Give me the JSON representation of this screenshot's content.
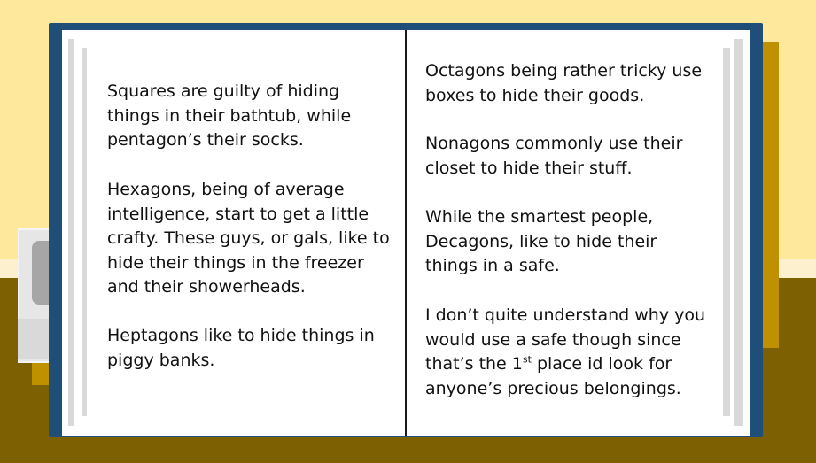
{
  "colors": {
    "wall": "#fee89c",
    "floor": "#7d6001",
    "gold": "#bf9000",
    "book_cover": "#1f4e79",
    "page": "#ffffff",
    "page_edge": "#d9d9d9"
  },
  "left_page": {
    "p1": "Squares are guilty of hiding\nthings in their bathtub, while\npentagon’s their socks.",
    "p2": "Hexagons, being of average\nintelligence, start to get a little\ncrafty. These guys, or gals, like to\nhide their things in the freezer\nand their showerheads.",
    "p3": "Heptagons like to hide things in\npiggy banks."
  },
  "right_page": {
    "p1": "Octagons being rather tricky use\nboxes to hide their goods.",
    "p2": "Nonagons commonly use their\ncloset to hide their stuff.",
    "p3": "While the smartest people,\nDecagons, like to hide their\nthings in a safe.",
    "p4_line1": "I don’t quite understand why you",
    "p4_line2": "would use a safe though since",
    "p4_line3_before": "that’s the 1",
    "p4_line3_sup": "st",
    "p4_line3_after": " place id look for",
    "p4_line4": "anyone’s precious belongings."
  }
}
